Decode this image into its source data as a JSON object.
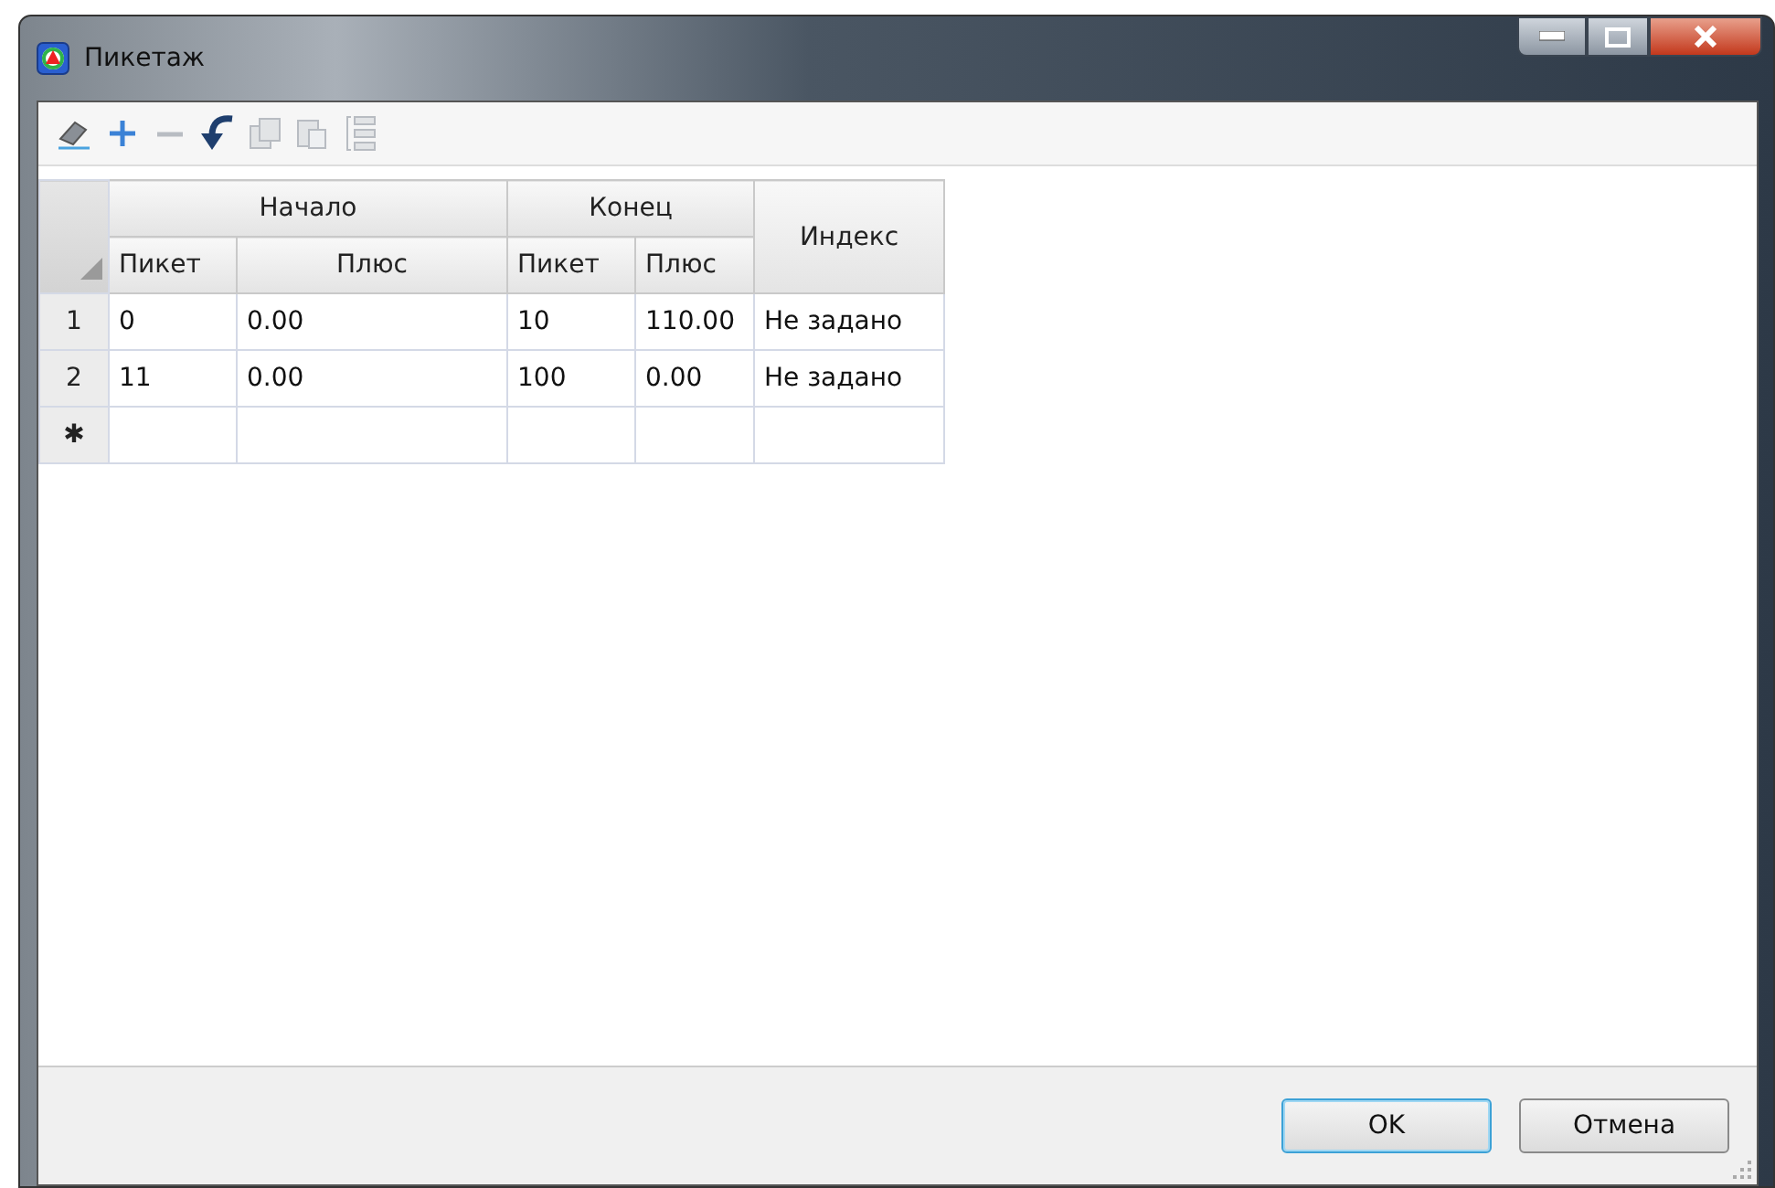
{
  "window": {
    "title": "Пикетаж"
  },
  "toolbar": [
    {
      "kind": "eraser",
      "disabled": false
    },
    {
      "kind": "add",
      "disabled": false
    },
    {
      "kind": "remove",
      "disabled": true
    },
    {
      "kind": "undo",
      "disabled": false
    },
    {
      "kind": "copy",
      "disabled": true
    },
    {
      "kind": "paste",
      "disabled": true
    },
    {
      "kind": "list",
      "disabled": true
    }
  ],
  "table": {
    "groups": [
      {
        "label": "Начало"
      },
      {
        "label": "Конец"
      }
    ],
    "columns": [
      "Пикет",
      "Плюс",
      "Пикет",
      "Плюс"
    ],
    "index_column": "Индекс",
    "rows": [
      {
        "header": "1",
        "cells": [
          "0",
          "0.00",
          "10",
          "110.00",
          "Не задано"
        ]
      },
      {
        "header": "2",
        "cells": [
          "11",
          "0.00",
          "100",
          "0.00",
          "Не задано"
        ]
      }
    ],
    "new_row_marker": "✱"
  },
  "buttons": [
    {
      "label": "OK",
      "selected": true
    },
    {
      "label": "Отмена",
      "selected": false
    }
  ]
}
